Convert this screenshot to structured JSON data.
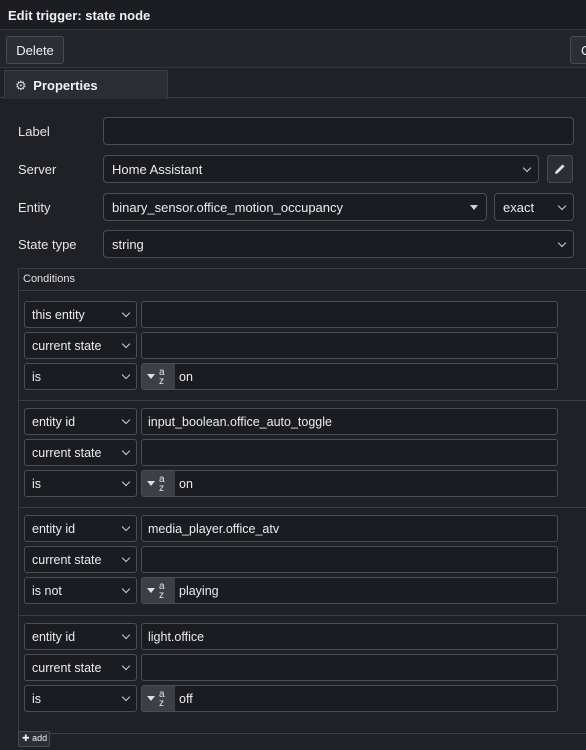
{
  "title": "Edit trigger: state node",
  "toolbar": {
    "delete_label": "Delete",
    "cut_label": "C"
  },
  "tabs": [
    {
      "label": "Properties",
      "icon": "gear-icon"
    }
  ],
  "form": {
    "label_label": "Label",
    "label_value": "",
    "server_label": "Server",
    "server_value": "Home Assistant",
    "entity_label": "Entity",
    "entity_value": "binary_sensor.office_motion_occupancy",
    "entity_match": "exact",
    "state_type_label": "State type",
    "state_type_value": "string"
  },
  "conditions": {
    "header": "Conditions",
    "groups": [
      {
        "target": "this entity",
        "target_value": "",
        "property": "current state",
        "property_value": "",
        "operator": "is",
        "compare_value": "on"
      },
      {
        "target": "entity id",
        "target_value": "input_boolean.office_auto_toggle",
        "property": "current state",
        "property_value": "",
        "operator": "is",
        "compare_value": "on"
      },
      {
        "target": "entity id",
        "target_value": "media_player.office_atv",
        "property": "current state",
        "property_value": "",
        "operator": "is not",
        "compare_value": "playing"
      },
      {
        "target": "entity id",
        "target_value": "light.office",
        "property": "current state",
        "property_value": "",
        "operator": "is",
        "compare_value": "off"
      }
    ],
    "type_icon_main": "a",
    "type_icon_sub": "z",
    "add_label": "add"
  }
}
